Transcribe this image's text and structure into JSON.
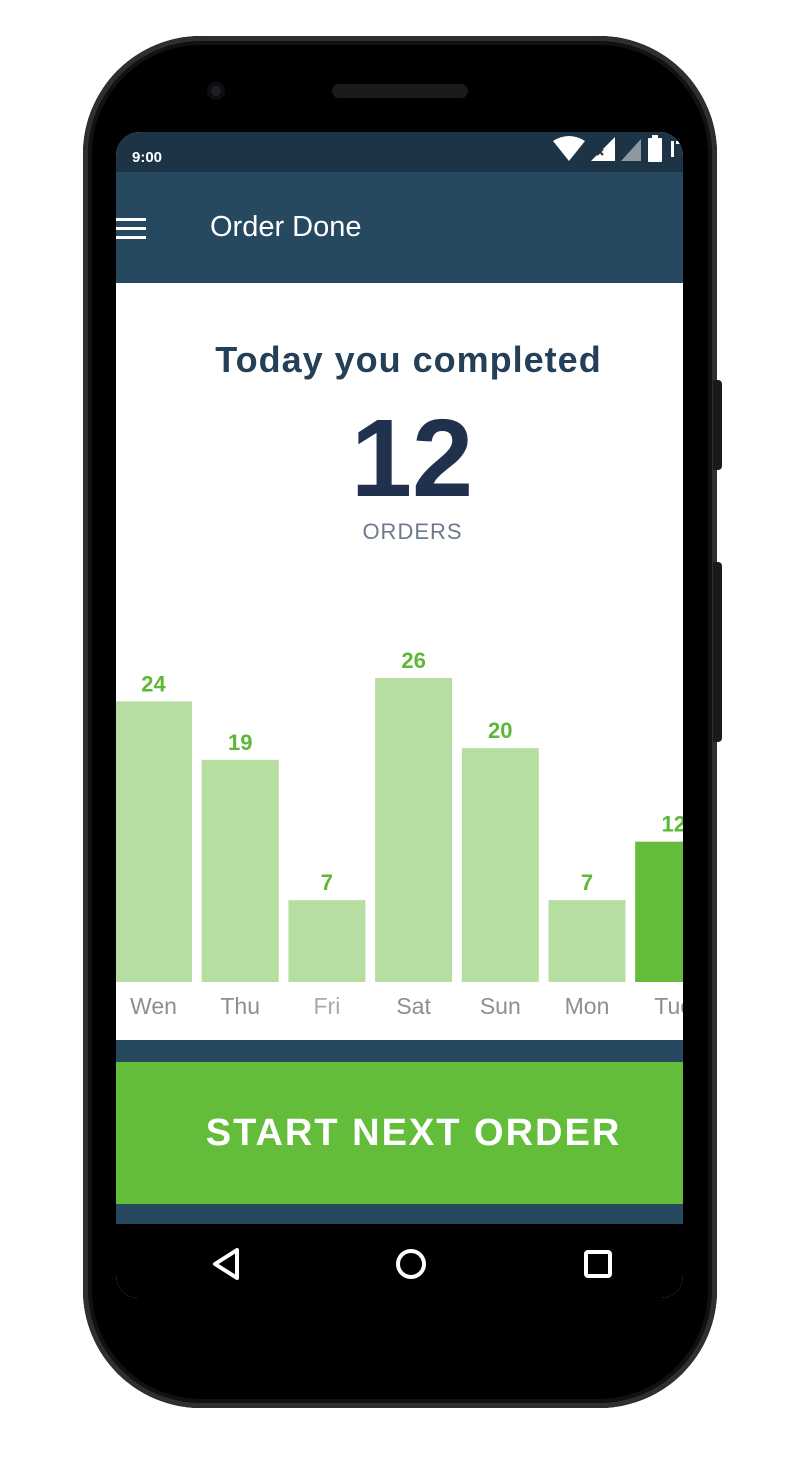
{
  "status_bar": {
    "time": "9:00"
  },
  "app_bar": {
    "title": "Order Done"
  },
  "summary": {
    "heading": "Today you completed",
    "count": "12",
    "unit": "ORDERS"
  },
  "action": {
    "label": "START NEXT ORDER"
  },
  "colors": {
    "primary": "#264960",
    "accent_green": "#63bc3a",
    "bar_light": "#b5dea0",
    "value_label": "#5cb836",
    "count_text": "#20314d"
  },
  "chart_data": {
    "type": "bar",
    "categories": [
      "Wen",
      "Thu",
      "Fri",
      "Sat",
      "Sun",
      "Mon",
      "Tue"
    ],
    "values": [
      24,
      19,
      7,
      26,
      20,
      7,
      12
    ],
    "highlight_index": 6,
    "title": "",
    "xlabel": "",
    "ylabel": "",
    "ylim": [
      0,
      26
    ]
  }
}
